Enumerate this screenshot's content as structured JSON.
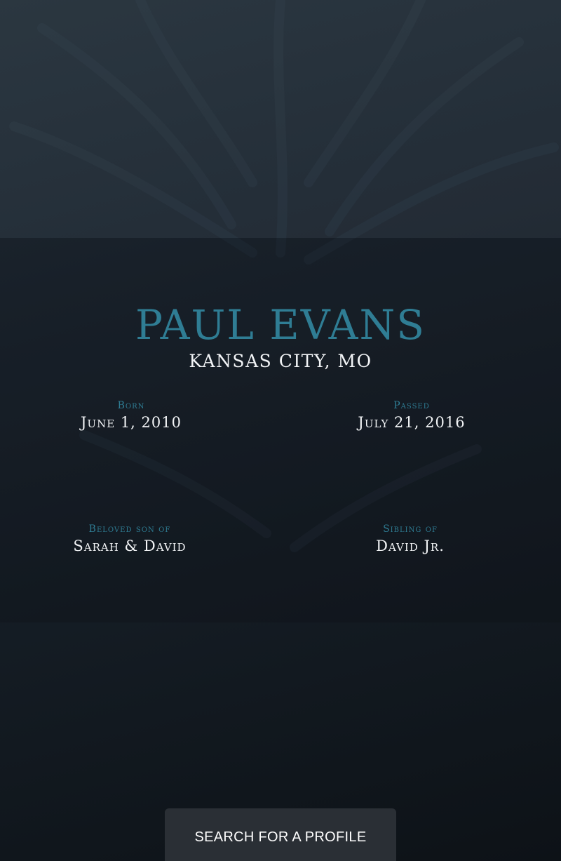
{
  "profile": {
    "name": "PAUL EVANS",
    "location": "KANSAS CITY, MO"
  },
  "details": {
    "born": {
      "label": "Born",
      "value": "June 1, 2010"
    },
    "passed": {
      "label": "Passed",
      "value": "July 21, 2016"
    },
    "parents": {
      "label": "Beloved son of",
      "value": "Sarah & David"
    },
    "sibling": {
      "label": "Sibling of",
      "value": "David Jr."
    }
  },
  "actions": {
    "search_label": "SEARCH FOR A PROFILE"
  },
  "colors": {
    "accent": "#2f7d94",
    "text": "#f2f4f6",
    "button_bg": "#2a2f35"
  }
}
